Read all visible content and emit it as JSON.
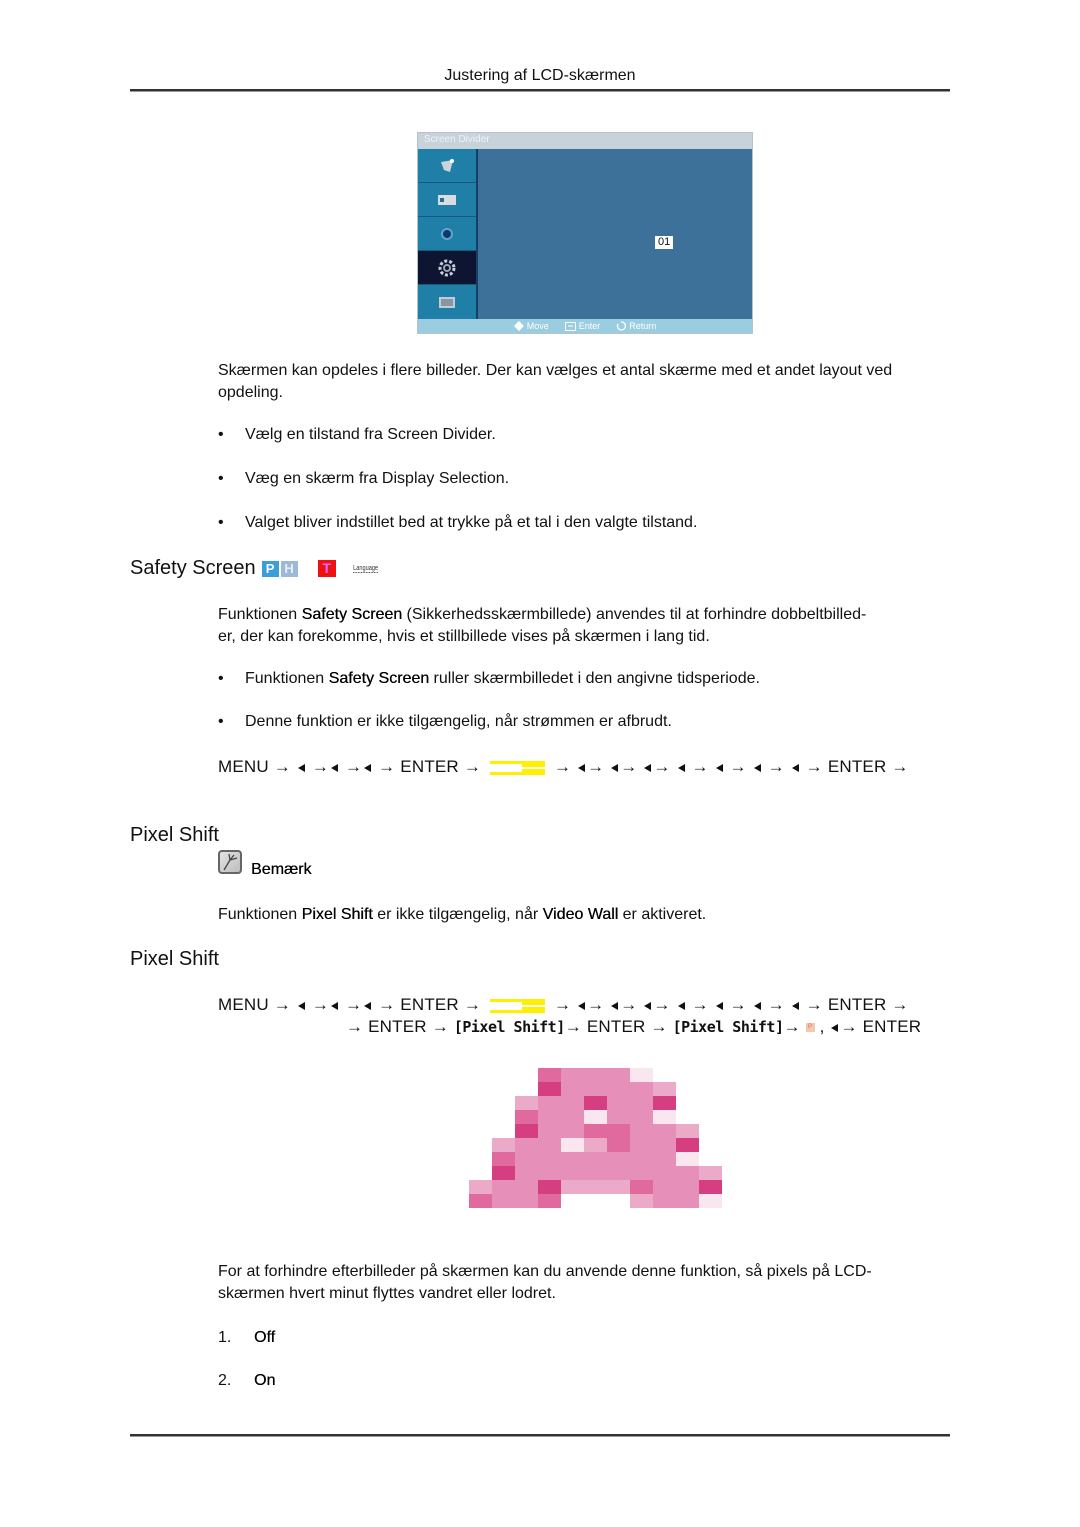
{
  "header": {
    "running_title": "Justering af LCD-skærmen"
  },
  "osd": {
    "title": "Screen Divider",
    "menu_icons": [
      "antenna-icon",
      "picture-icon",
      "sound-icon",
      "setup-gear-icon",
      "multi-control-icon"
    ],
    "active_index": 3,
    "selected_value": "01",
    "footer": {
      "move": "Move",
      "enter": "Enter",
      "return": "Return"
    }
  },
  "screen_divider": {
    "description": "Skærmen kan opdeles i flere billeder. Der kan vælges et antal skærme med et andet layout ved opdeling.",
    "bullets": [
      "Vælg en tilstand fra Screen Divider.",
      "Væg en skærm fra Display Selection.",
      "Valget bliver indstillet bed at trykke på et tal i den valgte tilstand."
    ]
  },
  "safety_screen": {
    "heading": "Safety Screen",
    "badges": {
      "p": "P",
      "h": "H",
      "t": "T",
      "lang": "Language"
    },
    "intro_prefix": "Funktionen ",
    "intro_term": "Safety Screen",
    "intro_line1_rest": " (Sikkerhedsskærmbillede) anvendes til at forhindre dobbeltbilled-",
    "intro_line2": "er, der kan forekomme, hvis et stillbillede vises på skærmen i lang tid.",
    "bullet1_prefix": "Funktionen ",
    "bullet1_term": "Safety Screen",
    "bullet1_rest": " ruller skærmbilledet i den angivne tidsperiode.",
    "bullet2": "Denne funktion er ikke tilgængelig, når strømmen er afbrudt.",
    "sequence": {
      "menu": "MENU",
      "enter": "ENTER",
      "arrow": "→"
    }
  },
  "pixel_shift_note": {
    "heading": "Pixel Shift",
    "note_label": "Bemærk",
    "text_prefix": "Funktionen ",
    "term1": "Pixel Shift",
    "text_mid": " er ikke tilgængelig, når ",
    "term2": "Video Wall",
    "text_suffix": " er aktiveret."
  },
  "pixel_shift": {
    "heading": "Pixel Shift",
    "sequence": {
      "menu": "MENU",
      "enter": "ENTER",
      "arrow": "→",
      "bracket_label": "[Pixel Shift]",
      "comma": ","
    },
    "description_line1": "For at forhindre efterbilleder på skærmen kan du anvende denne funktion, så pixels på LCD-",
    "description_line2": "skærmen hvert minut flyttes vandret eller lodret.",
    "options": [
      {
        "number": "1.",
        "label": "Off"
      },
      {
        "number": "2.",
        "label": "On"
      }
    ]
  },
  "colors": {
    "pixel_light": "#f9e6ee",
    "pixel_soft": "#ebaac8",
    "pixel_base": "#e68fb8",
    "pixel_mid": "#e06a9d",
    "pixel_dark": "#d63e82",
    "osd_blue": "#3e7199",
    "highlight_yellow": "#ffef00"
  }
}
